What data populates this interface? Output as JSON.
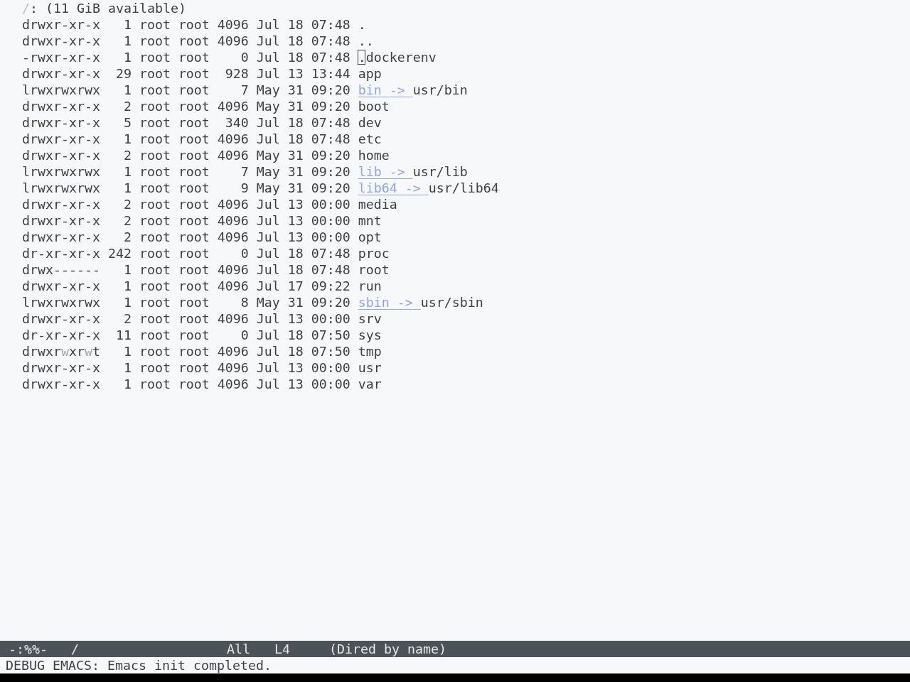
{
  "buffer": {
    "header": {
      "directory": "/",
      "free_space": ": (11 GiB available)"
    },
    "entries": [
      {
        "kind": "plain",
        "permissions": [
          {
            "text": "drwxr-xr-x",
            "dim": false
          }
        ],
        "links": "1",
        "owner": "root",
        "group": "root",
        "size": "4096",
        "date": "Jul 18",
        "time": "07:48",
        "name": ".",
        "cursor": false
      },
      {
        "kind": "plain",
        "permissions": [
          {
            "text": "drwxr-xr-x",
            "dim": false
          }
        ],
        "links": "1",
        "owner": "root",
        "group": "root",
        "size": "4096",
        "date": "Jul 18",
        "time": "07:48",
        "name": "..",
        "cursor": false
      },
      {
        "kind": "plain",
        "permissions": [
          {
            "text": "-rwxr-xr-x",
            "dim": false
          }
        ],
        "links": "1",
        "owner": "root",
        "group": "root",
        "size": "0",
        "date": "Jul 18",
        "time": "07:48",
        "name": ".dockerenv",
        "cursor": true
      },
      {
        "kind": "plain",
        "permissions": [
          {
            "text": "drwxr-xr-x",
            "dim": false
          }
        ],
        "links": "29",
        "owner": "root",
        "group": "root",
        "size": "928",
        "date": "Jul 13",
        "time": "13:44",
        "name": "app",
        "cursor": false
      },
      {
        "kind": "symlink",
        "permissions": [
          {
            "text": "lrwxrwxrwx",
            "dim": false
          }
        ],
        "links": "1",
        "owner": "root",
        "group": "root",
        "size": "7",
        "date": "May 31",
        "time": "09:20",
        "name": "bin",
        "arrow": "->",
        "target": "usr/bin",
        "cursor": false
      },
      {
        "kind": "plain",
        "permissions": [
          {
            "text": "drwxr-xr-x",
            "dim": false
          }
        ],
        "links": "2",
        "owner": "root",
        "group": "root",
        "size": "4096",
        "date": "May 31",
        "time": "09:20",
        "name": "boot",
        "cursor": false
      },
      {
        "kind": "plain",
        "permissions": [
          {
            "text": "drwxr-xr-x",
            "dim": false
          }
        ],
        "links": "5",
        "owner": "root",
        "group": "root",
        "size": "340",
        "date": "Jul 18",
        "time": "07:48",
        "name": "dev",
        "cursor": false
      },
      {
        "kind": "plain",
        "permissions": [
          {
            "text": "drwxr-xr-x",
            "dim": false
          }
        ],
        "links": "1",
        "owner": "root",
        "group": "root",
        "size": "4096",
        "date": "Jul 18",
        "time": "07:48",
        "name": "etc",
        "cursor": false
      },
      {
        "kind": "plain",
        "permissions": [
          {
            "text": "drwxr-xr-x",
            "dim": false
          }
        ],
        "links": "2",
        "owner": "root",
        "group": "root",
        "size": "4096",
        "date": "May 31",
        "time": "09:20",
        "name": "home",
        "cursor": false
      },
      {
        "kind": "symlink",
        "permissions": [
          {
            "text": "lrwxrwxrwx",
            "dim": false
          }
        ],
        "links": "1",
        "owner": "root",
        "group": "root",
        "size": "7",
        "date": "May 31",
        "time": "09:20",
        "name": "lib",
        "arrow": "->",
        "target": "usr/lib",
        "cursor": false
      },
      {
        "kind": "symlink",
        "permissions": [
          {
            "text": "lrwxrwxrwx",
            "dim": false
          }
        ],
        "links": "1",
        "owner": "root",
        "group": "root",
        "size": "9",
        "date": "May 31",
        "time": "09:20",
        "name": "lib64",
        "arrow": "->",
        "target": "usr/lib64",
        "cursor": false
      },
      {
        "kind": "plain",
        "permissions": [
          {
            "text": "drwxr-xr-x",
            "dim": false
          }
        ],
        "links": "2",
        "owner": "root",
        "group": "root",
        "size": "4096",
        "date": "Jul 13",
        "time": "00:00",
        "name": "media",
        "cursor": false
      },
      {
        "kind": "plain",
        "permissions": [
          {
            "text": "drwxr-xr-x",
            "dim": false
          }
        ],
        "links": "2",
        "owner": "root",
        "group": "root",
        "size": "4096",
        "date": "Jul 13",
        "time": "00:00",
        "name": "mnt",
        "cursor": false
      },
      {
        "kind": "plain",
        "permissions": [
          {
            "text": "drwxr-xr-x",
            "dim": false
          }
        ],
        "links": "2",
        "owner": "root",
        "group": "root",
        "size": "4096",
        "date": "Jul 13",
        "time": "00:00",
        "name": "opt",
        "cursor": false
      },
      {
        "kind": "plain",
        "permissions": [
          {
            "text": "dr-xr-xr-x",
            "dim": false
          }
        ],
        "links": "242",
        "owner": "root",
        "group": "root",
        "size": "0",
        "date": "Jul 18",
        "time": "07:48",
        "name": "proc",
        "cursor": false
      },
      {
        "kind": "plain",
        "permissions": [
          {
            "text": "drwx------",
            "dim": false
          }
        ],
        "links": "1",
        "owner": "root",
        "group": "root",
        "size": "4096",
        "date": "Jul 18",
        "time": "07:48",
        "name": "root",
        "cursor": false
      },
      {
        "kind": "plain",
        "permissions": [
          {
            "text": "drwxr-xr-x",
            "dim": false
          }
        ],
        "links": "1",
        "owner": "root",
        "group": "root",
        "size": "4096",
        "date": "Jul 17",
        "time": "09:22",
        "name": "run",
        "cursor": false
      },
      {
        "kind": "symlink",
        "permissions": [
          {
            "text": "lrwxrwxrwx",
            "dim": false
          }
        ],
        "links": "1",
        "owner": "root",
        "group": "root",
        "size": "8",
        "date": "May 31",
        "time": "09:20",
        "name": "sbin",
        "arrow": "->",
        "target": "usr/sbin",
        "cursor": false
      },
      {
        "kind": "plain",
        "permissions": [
          {
            "text": "drwxr-xr-x",
            "dim": false
          }
        ],
        "links": "2",
        "owner": "root",
        "group": "root",
        "size": "4096",
        "date": "Jul 13",
        "time": "00:00",
        "name": "srv",
        "cursor": false
      },
      {
        "kind": "plain",
        "permissions": [
          {
            "text": "dr-xr-xr-x",
            "dim": false
          }
        ],
        "links": "11",
        "owner": "root",
        "group": "root",
        "size": "0",
        "date": "Jul 18",
        "time": "07:50",
        "name": "sys",
        "cursor": false
      },
      {
        "kind": "plain",
        "permissions": [
          {
            "text": "drwxr",
            "dim": false
          },
          {
            "text": "w",
            "dim": true
          },
          {
            "text": "xr",
            "dim": false
          },
          {
            "text": "w",
            "dim": true
          },
          {
            "text": "t",
            "dim": false
          }
        ],
        "links": "1",
        "owner": "root",
        "group": "root",
        "size": "4096",
        "date": "Jul 18",
        "time": "07:50",
        "name": "tmp",
        "cursor": false
      },
      {
        "kind": "plain",
        "permissions": [
          {
            "text": "drwxr-xr-x",
            "dim": false
          }
        ],
        "links": "1",
        "owner": "root",
        "group": "root",
        "size": "4096",
        "date": "Jul 13",
        "time": "00:00",
        "name": "usr",
        "cursor": false
      },
      {
        "kind": "plain",
        "permissions": [
          {
            "text": "drwxr-xr-x",
            "dim": false
          }
        ],
        "links": "1",
        "owner": "root",
        "group": "root",
        "size": "4096",
        "date": "Jul 13",
        "time": "00:00",
        "name": "var",
        "cursor": false
      }
    ]
  },
  "mode_line": {
    "status": "-:%%-",
    "buffer_name": "/",
    "position": "All",
    "line": "L4",
    "mode": "(Dired by name)"
  },
  "echo_area": {
    "message": "DEBUG EMACS: Emacs init completed."
  }
}
